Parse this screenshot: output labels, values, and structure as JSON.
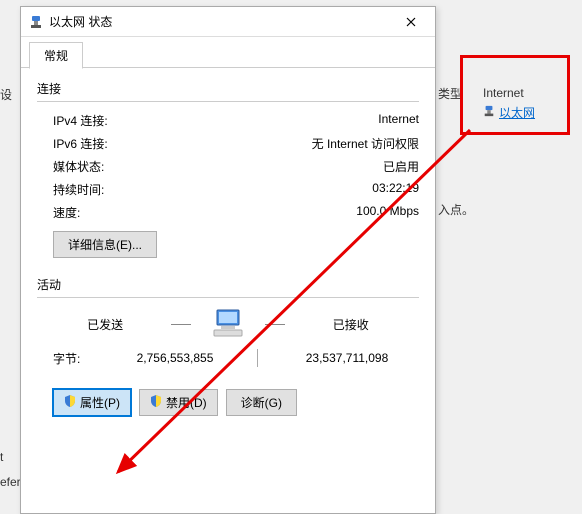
{
  "dialog": {
    "title": "以太网 状态",
    "close": "✕",
    "tab": "常规",
    "connection_section": "连接",
    "rows": {
      "ipv4_label": "IPv4 连接:",
      "ipv4_value": "Internet",
      "ipv6_label": "IPv6 连接:",
      "ipv6_value": "无 Internet 访问权限",
      "media_label": "媒体状态:",
      "media_value": "已启用",
      "duration_label": "持续时间:",
      "duration_value": "03:22:19",
      "speed_label": "速度:",
      "speed_value": "100.0 Mbps"
    },
    "details_btn": "详细信息(E)...",
    "activity_section": "活动",
    "sent_label": "已发送",
    "recv_label": "已接收",
    "bytes_label": "字节:",
    "bytes_sent": "2,756,553,855",
    "bytes_recv": "23,537,711,098",
    "prop_btn": "属性(P)",
    "disable_btn": "禁用(D)",
    "diag_btn": "诊断(G)"
  },
  "bg": {
    "settings": "设",
    "type": "类型",
    "access": "入点。",
    "t": "t",
    "efer": "efer"
  },
  "rightbox": {
    "internet": "Internet",
    "ethernet": "以太网"
  }
}
